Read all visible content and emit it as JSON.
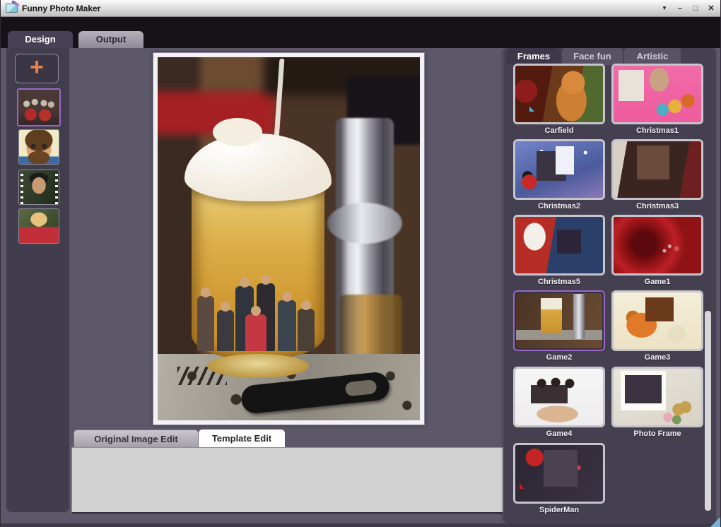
{
  "window": {
    "title": "Funny Photo Maker",
    "controls": {
      "menu": "▼",
      "minimize": "–",
      "maximize": "□",
      "close": "✕"
    }
  },
  "main_tabs": [
    {
      "label": "Design",
      "active": true
    },
    {
      "label": "Output",
      "active": false
    }
  ],
  "sidebar": {
    "add_button_label": "+",
    "photos": [
      {
        "name": "group-photo",
        "selected": true
      },
      {
        "name": "cartoon-avatar",
        "selected": false
      },
      {
        "name": "woman-filmstrip",
        "selected": false
      },
      {
        "name": "blonde-red-dress",
        "selected": false
      }
    ]
  },
  "preview": {
    "description": "Group photo composited inside a beer glass on a bar drip tray with chrome tap"
  },
  "bottom_tabs": [
    {
      "label": "Original Image Edit",
      "active": false
    },
    {
      "label": "Template Edit",
      "active": true
    }
  ],
  "right_panel": {
    "tabs": [
      {
        "label": "Frames",
        "active": true
      },
      {
        "label": "Face fun",
        "active": false
      },
      {
        "label": "Artistic",
        "active": false
      }
    ],
    "frames": [
      {
        "label": "Carfield",
        "selected": false
      },
      {
        "label": "Christmas1",
        "selected": false
      },
      {
        "label": "Christmas2",
        "selected": false
      },
      {
        "label": "Christmas3",
        "selected": false
      },
      {
        "label": "Christmas5",
        "selected": false
      },
      {
        "label": "Game1",
        "selected": false
      },
      {
        "label": "Game2",
        "selected": true
      },
      {
        "label": "Game3",
        "selected": false
      },
      {
        "label": "Game4",
        "selected": false
      },
      {
        "label": "Photo Frame",
        "selected": false
      },
      {
        "label": "SpiderMan",
        "selected": false
      }
    ]
  },
  "colors": {
    "accent_selected": "#9a68c4",
    "add_plus_orange": "#e8834f",
    "main_background": "#5d5869",
    "panel_background": "#454050",
    "tabstrip_black": "#151318",
    "titlebar_silver": "#d9d9d9"
  }
}
